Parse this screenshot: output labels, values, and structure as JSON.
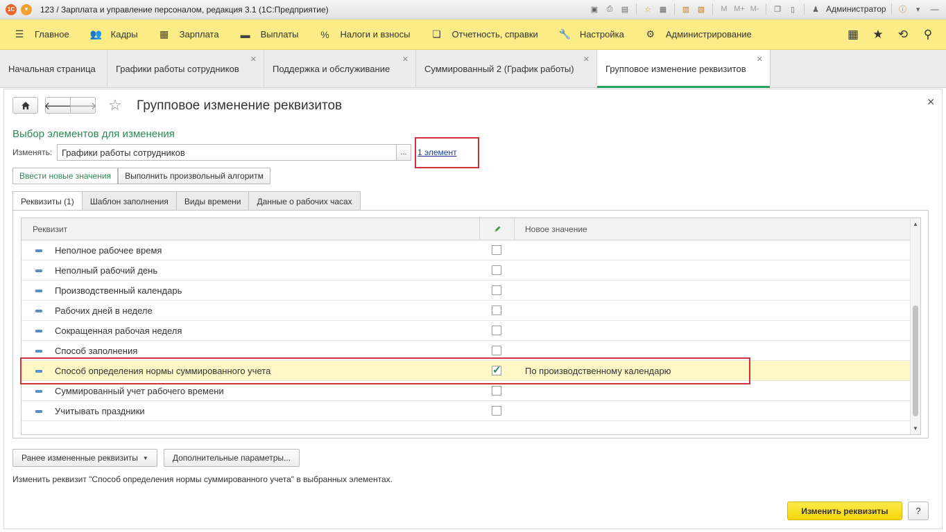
{
  "window": {
    "title": "123 / Зарплата и управление персоналом, редакция 3.1  (1С:Предприятие)",
    "user": "Администратор",
    "toolbar_marks": [
      "M",
      "M+",
      "M-"
    ]
  },
  "main_menu": {
    "items": [
      {
        "label": "Главное",
        "icon": "hamburger-icon"
      },
      {
        "label": "Кадры",
        "icon": "people-icon"
      },
      {
        "label": "Зарплата",
        "icon": "calculator-icon"
      },
      {
        "label": "Выплаты",
        "icon": "wallet-icon"
      },
      {
        "label": "Налоги и взносы",
        "icon": "percent-icon"
      },
      {
        "label": "Отчетность, справки",
        "icon": "documents-icon"
      },
      {
        "label": "Настройка",
        "icon": "wrench-icon"
      },
      {
        "label": "Администрирование",
        "icon": "gear-icon"
      }
    ],
    "right_icons": [
      "grid-icon",
      "star-icon",
      "history-icon",
      "search-icon"
    ]
  },
  "tabs": [
    {
      "label": "Начальная страница",
      "closable": false
    },
    {
      "label": "Графики работы сотрудников",
      "closable": true
    },
    {
      "label": "Поддержка и обслуживание",
      "closable": true
    },
    {
      "label": "Суммированный 2 (График работы)",
      "closable": true
    },
    {
      "label": "Групповое изменение реквизитов",
      "closable": true,
      "active": true
    }
  ],
  "form": {
    "title": "Групповое изменение реквизитов",
    "section_title": "Выбор элементов для изменения",
    "change_label": "Изменять:",
    "change_value": "Графики работы сотрудников",
    "ellipsis": "...",
    "selected_count_link": "1 элемент",
    "mode_buttons": [
      "Ввести новые значения",
      "Выполнить произвольный алгоритм"
    ],
    "subtabs": [
      "Реквизиты (1)",
      "Шаблон заполнения",
      "Виды времени",
      "Данные о рабочих часах"
    ]
  },
  "grid": {
    "headers": {
      "attribute": "Реквизит",
      "new_value": "Новое значение"
    },
    "rows": [
      {
        "name": "Неполное рабочее время",
        "checked": false,
        "value": ""
      },
      {
        "name": "Неполный рабочий день",
        "checked": false,
        "value": ""
      },
      {
        "name": "Производственный календарь",
        "checked": false,
        "value": ""
      },
      {
        "name": "Рабочих дней в неделе",
        "checked": false,
        "value": ""
      },
      {
        "name": "Сокращенная рабочая неделя",
        "checked": false,
        "value": ""
      },
      {
        "name": "Способ заполнения",
        "checked": false,
        "value": ""
      },
      {
        "name": "Способ определения нормы суммированного учета",
        "checked": true,
        "value": "По производственному календарю",
        "selected": true
      },
      {
        "name": "Суммированный учет рабочего времени",
        "checked": false,
        "value": ""
      },
      {
        "name": "Учитывать праздники",
        "checked": false,
        "value": ""
      }
    ]
  },
  "footer": {
    "previously_changed": "Ранее измененные реквизиты",
    "additional_params": "Дополнительные параметры...",
    "hint": "Изменить реквизит \"Способ определения нормы суммированного учета\" в выбранных элементах.",
    "submit": "Изменить реквизиты",
    "help": "?"
  },
  "colors": {
    "menu_bg": "#fbec88",
    "accent_green": "#2a8a55",
    "highlight_red": "#d32f3c",
    "primary_button": "#f6d70c",
    "selected_row": "#fdf8c6"
  }
}
